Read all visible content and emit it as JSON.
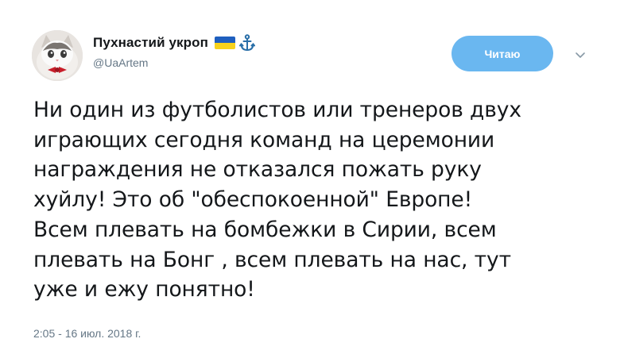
{
  "author": {
    "display_name": "Пухнастий укроп",
    "handle": "@UaArtem",
    "badges": [
      "ukraine-flag-icon",
      "anchor-icon"
    ]
  },
  "follow_button": {
    "label": "Читаю"
  },
  "tweet": {
    "lines": [
      "Ни один из футболистов или тренеров двух",
      "играющих сегодня команд на церемонии",
      "награждения не отказался пожать руку",
      "хуйлу! Это об \"обеспокоенной\" Европе!",
      "Всем плевать на бомбежки в Сирии, всем",
      "плевать на Бонг , всем плевать на нас, тут",
      "уже и ежу понятно!"
    ],
    "timestamp": "2:05 - 16 июл. 2018 г."
  },
  "colors": {
    "button_bg": "#6ab7f0",
    "secondary_text": "#657786",
    "anchor": "#2a6fa8",
    "flag_blue": "#1f5fbf",
    "flag_yellow": "#f7d21c"
  }
}
